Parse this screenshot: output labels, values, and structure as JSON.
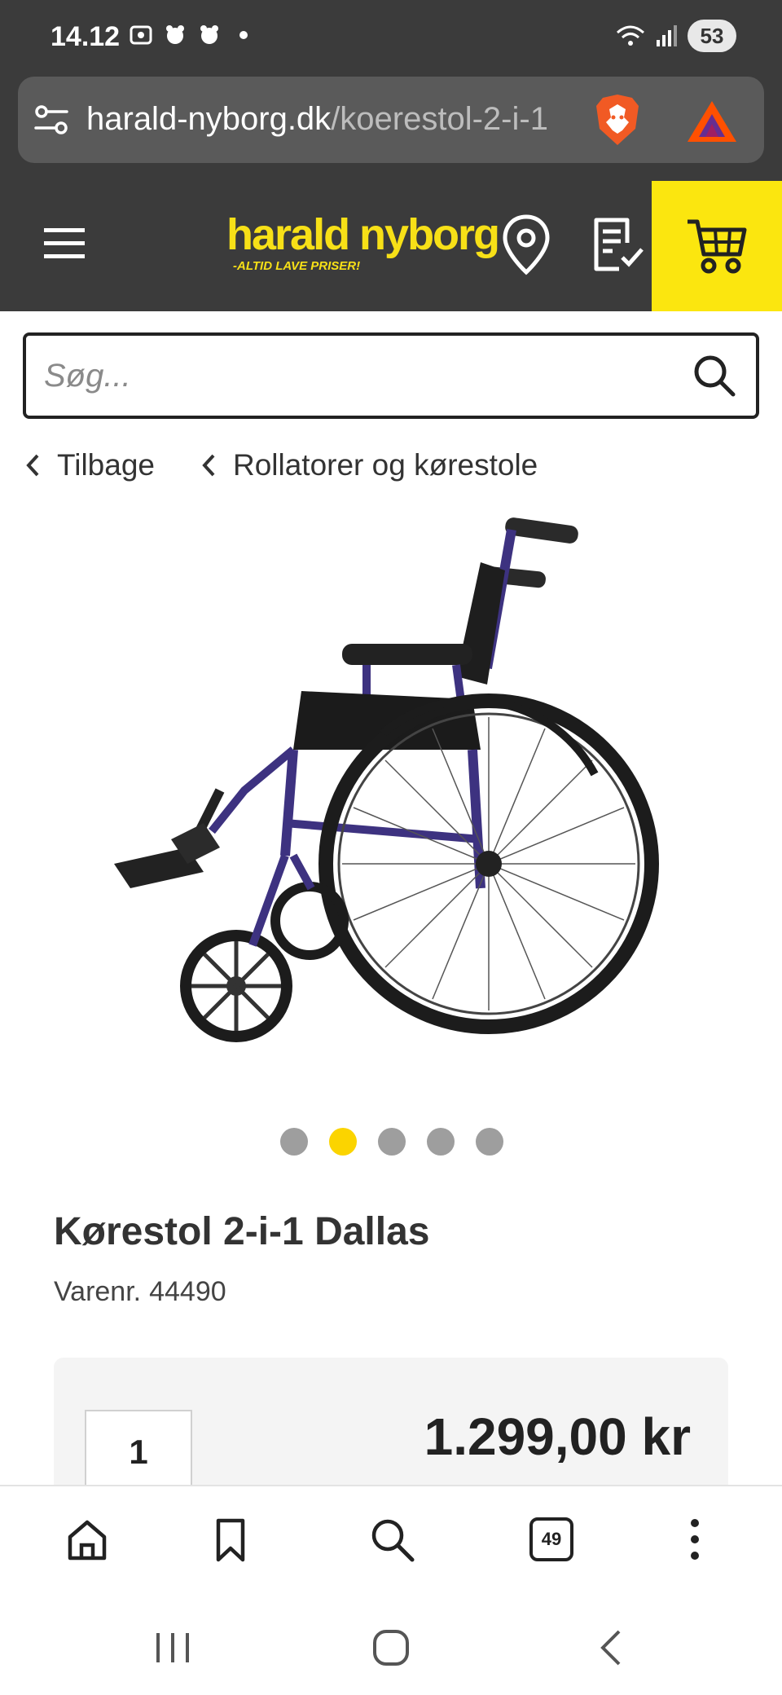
{
  "status_bar": {
    "time": "14.12",
    "battery": "53"
  },
  "browser": {
    "url_domain": "harald-nyborg.dk",
    "url_path": "/koerestol-2-i-1",
    "tab_count": "49"
  },
  "header": {
    "logo_main": "harald nyborg",
    "logo_tagline": "-ALTID LAVE PRISER!",
    "brand_color": "#fbe60f",
    "header_color": "#3b3b3b"
  },
  "search": {
    "placeholder": "Søg..."
  },
  "breadcrumbs": {
    "back_label": "Tilbage",
    "category_label": "Rollatorer og kørestole"
  },
  "carousel": {
    "total": 5,
    "active_index": 1
  },
  "product": {
    "title": "Kørestol 2-i-1 Dallas",
    "sku_label": "Varenr.",
    "sku_value": "44490",
    "quantity": "1",
    "price": "1.299,00 kr"
  },
  "icons": {
    "menu": "hamburger-icon",
    "store_locator": "location-pin-icon",
    "shopping_list": "checklist-icon",
    "cart": "shopping-cart-icon",
    "search": "search-icon",
    "home": "home-icon",
    "bookmark": "bookmark-icon",
    "more": "more-vertical-icon"
  }
}
